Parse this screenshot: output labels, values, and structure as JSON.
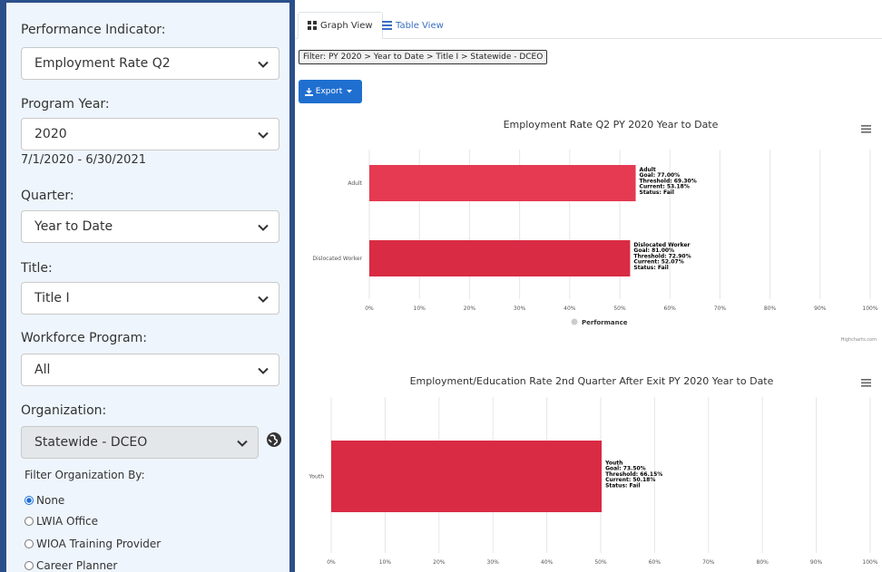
{
  "sidebar": {
    "performance_indicator": {
      "label": "Performance Indicator:",
      "value": "Employment Rate Q2"
    },
    "program_year": {
      "label": "Program Year:",
      "value": "2020",
      "dates": "7/1/2020 - 6/30/2021"
    },
    "quarter": {
      "label": "Quarter:",
      "value": "Year to Date"
    },
    "title": {
      "label": "Title:",
      "value": "Title I"
    },
    "workforce_program": {
      "label": "Workforce Program:",
      "value": "All"
    },
    "organization": {
      "label": "Organization:",
      "value": "Statewide - DCEO"
    },
    "filter_org": {
      "label": "Filter Organization By:",
      "options": [
        "None",
        "LWIA Office",
        "WIOA Training Provider",
        "Career Planner"
      ],
      "selected": "None"
    }
  },
  "tabs": {
    "graph": "Graph View",
    "table": "Table View"
  },
  "filter_text": "Filter: PY 2020 > Year to Date > Title I > Statewide - DCEO",
  "export_label": "Export",
  "chart_data": [
    {
      "type": "bar",
      "orientation": "horizontal",
      "title": "Employment Rate Q2 PY 2020 Year to Date",
      "categories": [
        "Adult",
        "Dislocated Worker"
      ],
      "series": [
        {
          "name": "Performance",
          "values": [
            53.18,
            52.07
          ]
        }
      ],
      "tick_labels": [
        "0%",
        "10%",
        "20%",
        "30%",
        "40%",
        "50%",
        "60%",
        "70%",
        "80%",
        "90%",
        "100%"
      ],
      "xlim": [
        0,
        100
      ],
      "data_labels": [
        [
          "Adult",
          "Goal: 77.00%",
          "Threshold: 69.30%",
          "Current: 53.18%",
          "Status: Fail"
        ],
        [
          "Dislocated Worker",
          "Goal: 81.00%",
          "Threshold: 72.90%",
          "Current: 52.07%",
          "Status: Fail"
        ]
      ],
      "bar_colors": [
        "#e53a52",
        "#d92b43"
      ],
      "legend": "bottom",
      "credits": "Highcharts.com",
      "grid": true
    },
    {
      "type": "bar",
      "orientation": "horizontal",
      "title": "Employment/Education Rate 2nd Quarter After Exit PY 2020 Year to Date",
      "categories": [
        "Youth"
      ],
      "series": [
        {
          "values": [
            50.18
          ]
        }
      ],
      "tick_labels": [
        "0%",
        "10%",
        "20%",
        "30%",
        "40%",
        "50%",
        "60%",
        "70%",
        "80%",
        "90%",
        "100%"
      ],
      "xlim": [
        0,
        100
      ],
      "data_labels": [
        [
          "Youth",
          "Goal: 73.50%",
          "Threshold: 66.15%",
          "Current: 50.18%",
          "Status: Fail"
        ]
      ],
      "bar_colors": [
        "#d92b43"
      ],
      "grid": true
    }
  ],
  "colors": {
    "sidebar_border": "#2b4f8a",
    "sidebar_bg": "#eef5fc",
    "accent": "#1f6fd0"
  }
}
